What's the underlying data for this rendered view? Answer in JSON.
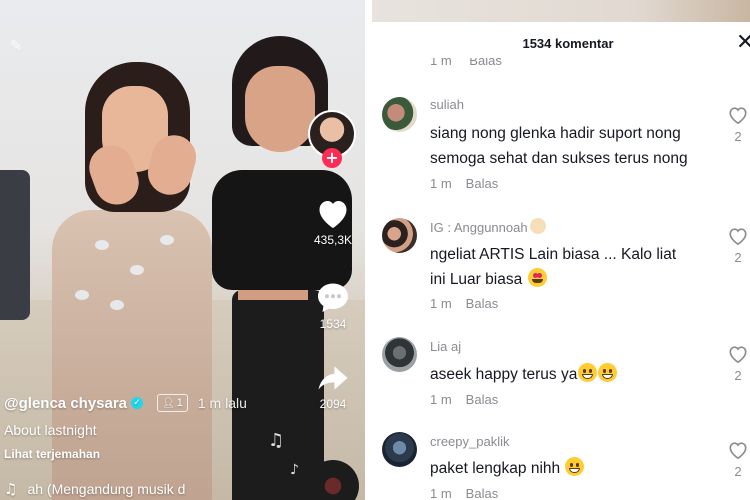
{
  "video": {
    "username": "@glenca chysara",
    "collab_count": "1",
    "time_ago": "1 m lalu",
    "caption": "About lastnight",
    "translate_label": "Lihat terjemahan",
    "music_text": "ah (Mengandung musik d",
    "likes": "435,3K",
    "comments": "1534",
    "shares": "2094",
    "accent_color": "#fe2c55",
    "verified_color": "#20d5ec"
  },
  "comments_panel": {
    "title": "1534 komentar",
    "clipped_meta": {
      "time": "1 m",
      "reply": "Balas"
    },
    "items": [
      {
        "user": "suliah",
        "lines": [
          "siang nong glenka hadir suport nong",
          "semoga sehat dan sukses terus nong"
        ],
        "time": "1 m",
        "reply": "Balas",
        "likes": "2"
      },
      {
        "user": "IG : Anggunnoah",
        "lines": [
          "ngeliat ARTIS Lain biasa ... Kalo liat",
          "ini Luar biasa"
        ],
        "time": "1 m",
        "reply": "Balas",
        "likes": "2"
      },
      {
        "user": "Lia aj",
        "lines": [
          "aseek happy terus ya"
        ],
        "time": "1 m",
        "reply": "Balas",
        "likes": "2"
      },
      {
        "user": "creepy_paklik",
        "lines": [
          "paket lengkap nihh"
        ],
        "time": "1 m",
        "reply": "Balas",
        "likes": "2"
      }
    ]
  }
}
